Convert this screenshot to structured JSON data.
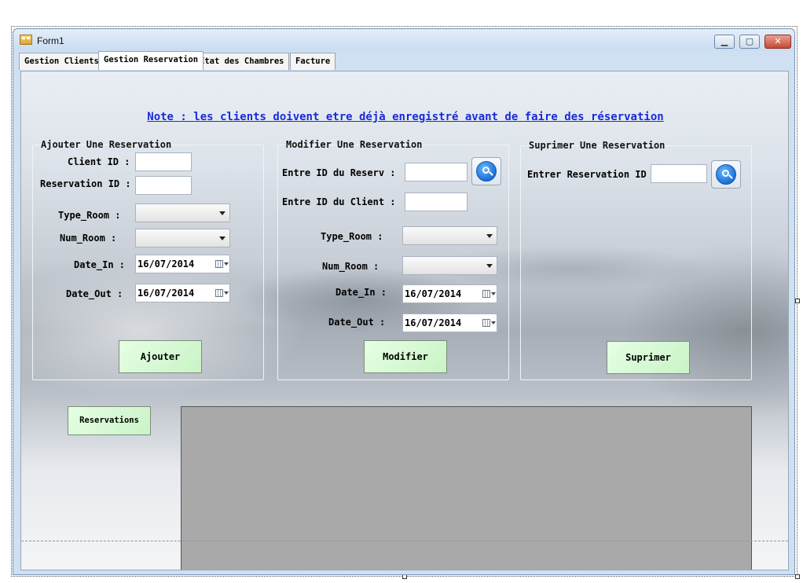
{
  "window": {
    "title": "Form1"
  },
  "tabs": [
    {
      "label": "Gestion Clients",
      "active": false
    },
    {
      "label": "Gestion Reservation",
      "active": true
    },
    {
      "label": "Etat des Chambres",
      "active": false
    },
    {
      "label": "Facture",
      "active": false
    }
  ],
  "note": "Note : les clients doivent etre déjà enregistré avant de faire des réservation",
  "add_group": {
    "title": "Ajouter Une Reservation",
    "client_id_label": "Client ID :",
    "reservation_id_label": "Reservation ID :",
    "type_room_label": "Type_Room :",
    "num_room_label": "Num_Room :",
    "date_in_label": "Date_In :",
    "date_in_value": "16/07/2014",
    "date_out_label": "Date_Out :",
    "date_out_value": "16/07/2014",
    "button": "Ajouter"
  },
  "modify_group": {
    "title": "Modifier Une Reservation",
    "reserv_id_label": "Entre ID du Reserv :",
    "client_id_label": "Entre ID du Client :",
    "type_room_label": "Type_Room :",
    "num_room_label": "Num_Room :",
    "date_in_label": "Date_In :",
    "date_in_value": "16/07/2014",
    "date_out_label": "Date_Out :",
    "date_out_value": "16/07/2014",
    "button": "Modifier"
  },
  "delete_group": {
    "title": "Suprimer Une Reservation",
    "reservation_id_label": "Entrer Reservation ID :",
    "button": "Suprimer"
  },
  "reservations_button": "Reservations",
  "icons": {
    "search": "search-icon",
    "calendar": "calendar-icon",
    "dropdown": "chevron-down-icon",
    "app": "form-icon"
  },
  "colors": {
    "note_text": "#1b2bd9",
    "button_bg": "#d6f7d3",
    "grid_bg": "#a9a9a9"
  }
}
